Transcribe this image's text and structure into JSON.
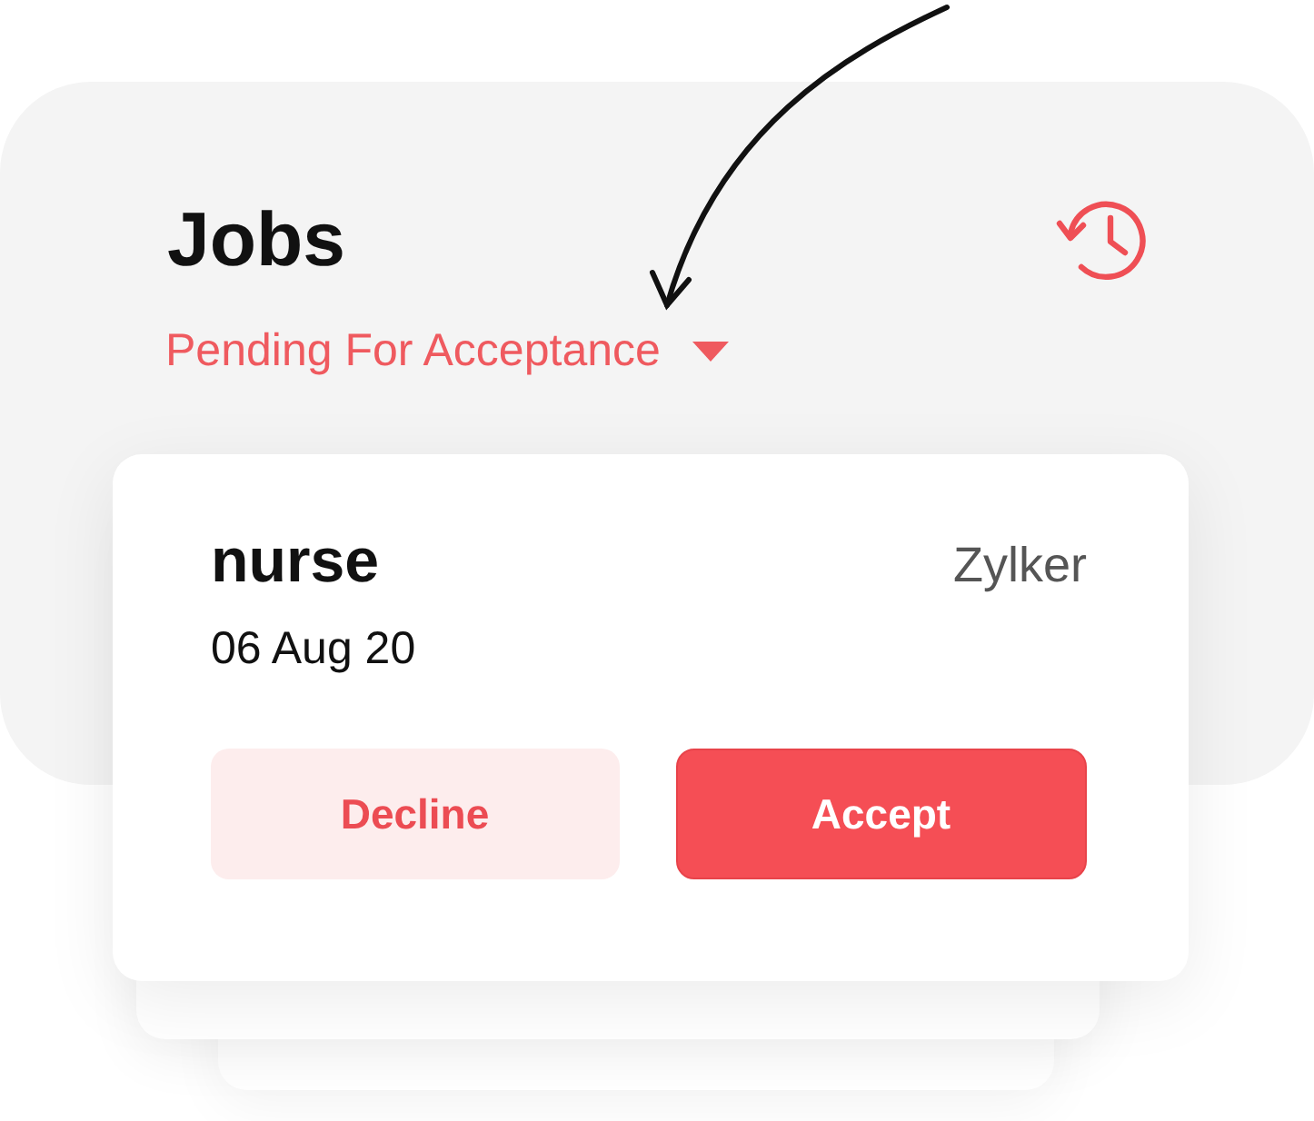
{
  "title": "Jobs",
  "filter": {
    "label": "Pending For Acceptance"
  },
  "job": {
    "title": "nurse",
    "company": "Zylker",
    "date": "06 Aug 20"
  },
  "buttons": [
    {
      "label": "Decline",
      "kind": "secondary"
    },
    {
      "label": "Accept",
      "kind": "primary"
    }
  ]
}
